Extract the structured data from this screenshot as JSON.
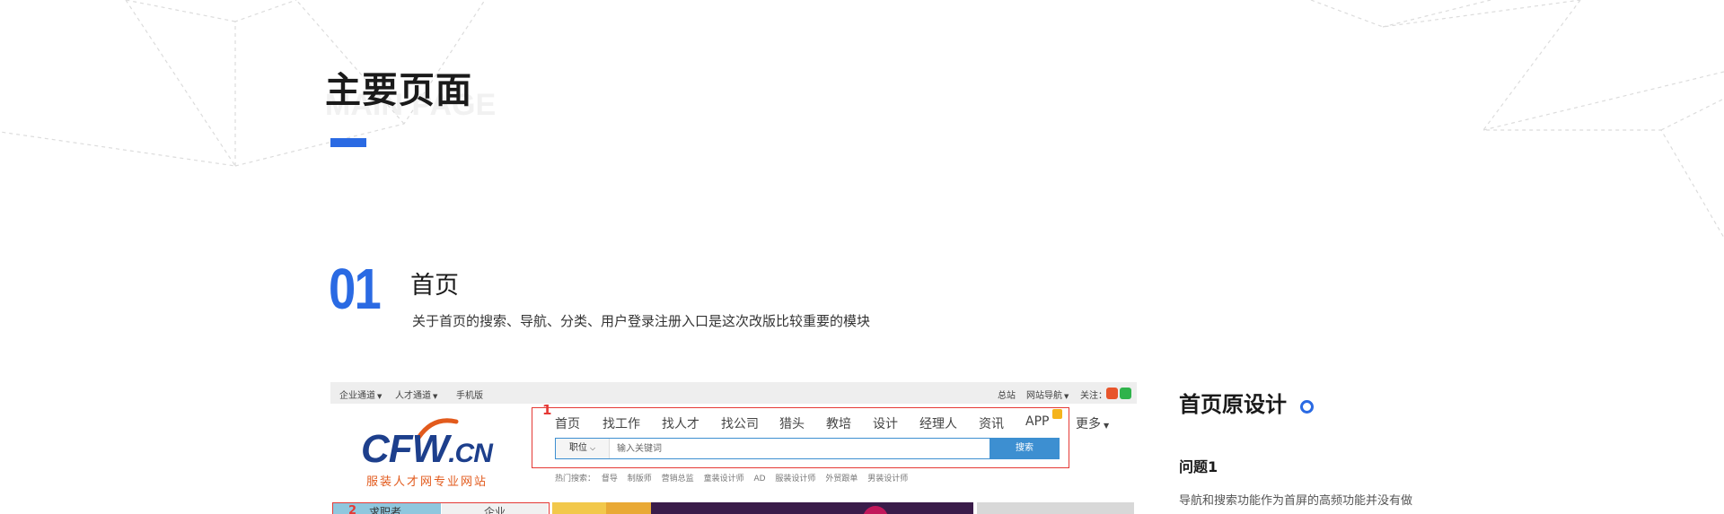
{
  "section": {
    "title": "主要页面",
    "subtitle": "MAIN PAGE"
  },
  "intro": {
    "number": "01",
    "title": "首页",
    "description": "关于首页的搜索、导航、分类、用户登录注册入口是这次改版比较重要的模块"
  },
  "screenshot": {
    "topbar": {
      "left_items": [
        "企业通道",
        "人才通道",
        "手机版"
      ],
      "right_items": [
        "总站",
        "网站导航"
      ],
      "follow_label": "关注："
    },
    "logo": {
      "brand": "CFW",
      "suffix": ".CN",
      "tagline": "服装人才网专业网站"
    },
    "annotations": [
      "1",
      "2"
    ],
    "nav": [
      "首页",
      "找工作",
      "找人才",
      "找公司",
      "猎头",
      "教培",
      "设计",
      "经理人",
      "资讯",
      "APP",
      "更多"
    ],
    "search": {
      "category": "职位",
      "placeholder": "输入关键词",
      "button": "搜索"
    },
    "hot_search": {
      "label": "热门搜索：",
      "items": [
        "督导",
        "制版师",
        "营销总监",
        "童装设计师",
        "AD",
        "服装设计师",
        "外贸跟单",
        "男装设计师"
      ]
    },
    "login_tabs": [
      "求职者",
      "企业"
    ]
  },
  "panel": {
    "title": "首页原设计",
    "issue_title": "问题1",
    "issue_description": "导航和搜索功能作为首屏的高频功能并没有做"
  },
  "colors": {
    "accent": "#2a6ae3",
    "annotation": "#e53935",
    "search_blue": "#3d8fd1",
    "logo_navy": "#1d3f8c",
    "logo_orange": "#e25a1c"
  }
}
